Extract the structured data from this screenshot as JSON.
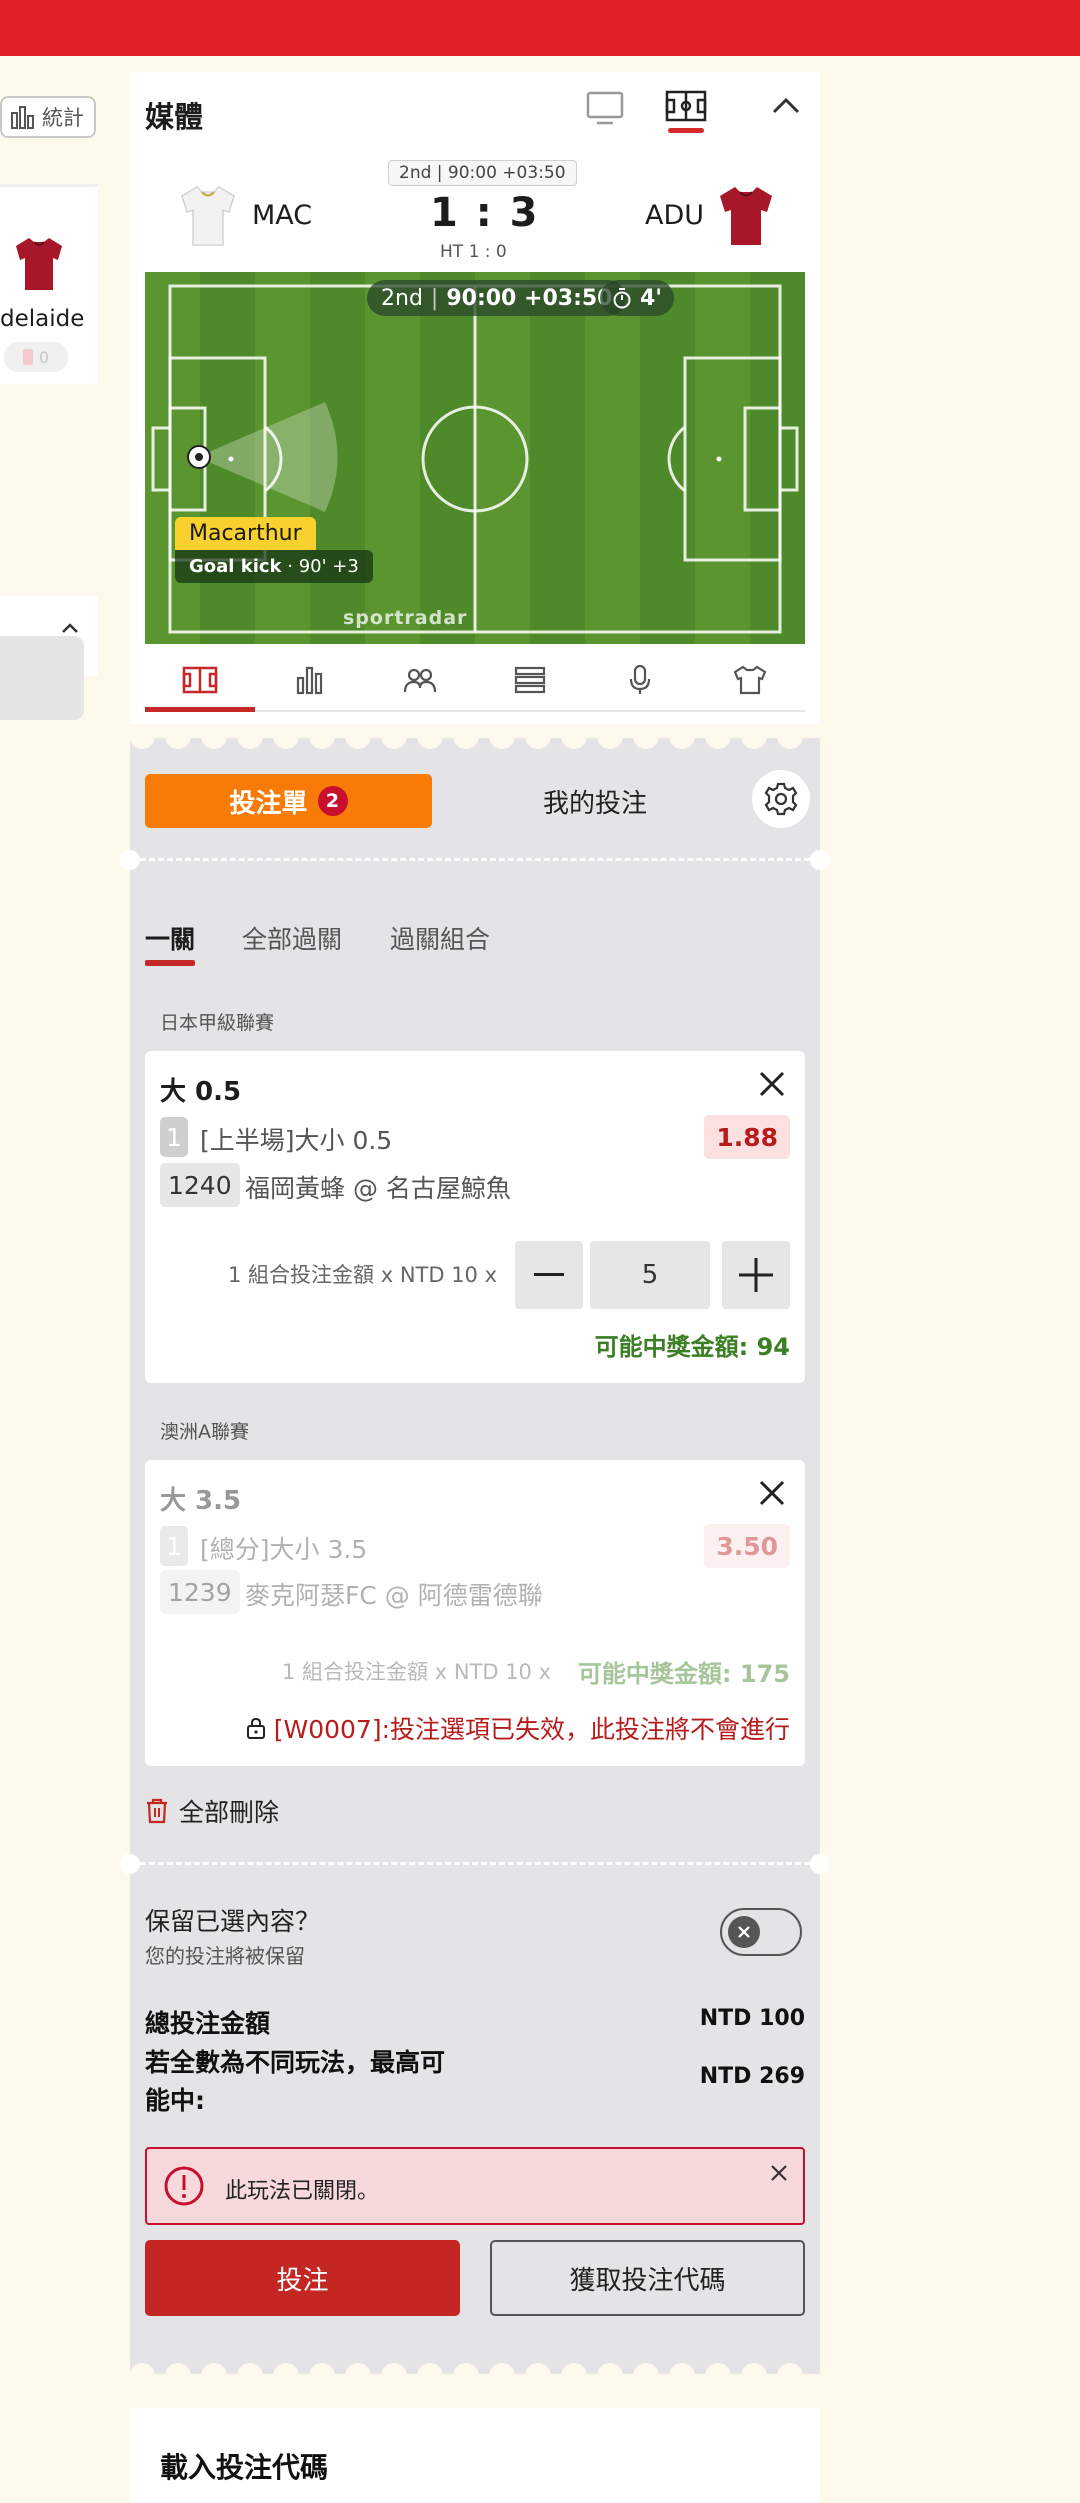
{
  "left_partial": {
    "stats_label": "統計",
    "team_name": "delaide",
    "card_count": "0"
  },
  "media": {
    "title": "媒體",
    "period": "2nd | 90:00 +03:50",
    "home_team": "MAC",
    "away_team": "ADU",
    "score": "1 : 3",
    "half_time": "HT 1 : 0",
    "pitch": {
      "period_label": "2nd",
      "clock": "90:00 +03:50",
      "added_time": "4'",
      "event_team": "Macarthur",
      "event_name": "Goal kick",
      "event_time": "· 90' +3",
      "brand": "sportradar"
    }
  },
  "bet_slip": {
    "tab_active": "投注單",
    "tab_active_badge": "2",
    "tab_other": "我的投注",
    "sub_tabs": [
      "一關",
      "全部過關",
      "過關組合"
    ],
    "bets": [
      {
        "league": "日本甲級聯賽",
        "selection": "大 0.5",
        "market_number": "1",
        "market": "[上半場]大小 0.5",
        "odds": "1.88",
        "match_id": "1240",
        "match": "福岡黃蜂 @ 名古屋鯨魚",
        "stake_label": "1 組合投注金額 x NTD 10 x",
        "stake_value": "5",
        "potential_win": "可能中獎金額: 94"
      },
      {
        "league": "澳洲A聯賽",
        "selection": "大 3.5",
        "market_number": "1",
        "market": "[總分]大小 3.5",
        "odds": "3.50",
        "match_id": "1239",
        "match": "麥克阿瑟FC @ 阿德雷德聯",
        "stake_label": "1 組合投注金額 x NTD 10 x",
        "potential_win": "可能中獎金額: 175",
        "error": "[W0007]:投注選項已失效，此投注將不會進行"
      }
    ],
    "delete_all": "全部刪除",
    "keep_title": "保留已選內容？",
    "keep_subtitle": "您的投注將被保留",
    "total_stake_label": "總投注金額",
    "total_stake_value": "NTD 100",
    "max_win_label_line1": "若全數為不同玩法，最高可",
    "max_win_label_line2": "能中:",
    "max_win_value": "NTD 269",
    "alert_text": "此玩法已關閉。",
    "bet_button": "投注",
    "code_button": "獲取投注代碼"
  },
  "load_code": {
    "title": "載入投注代碼"
  },
  "colors": {
    "brand_red": "#e01f26",
    "slip_orange": "#f77b06",
    "bet_red": "#c42623",
    "win_green": "#3b7f24"
  }
}
